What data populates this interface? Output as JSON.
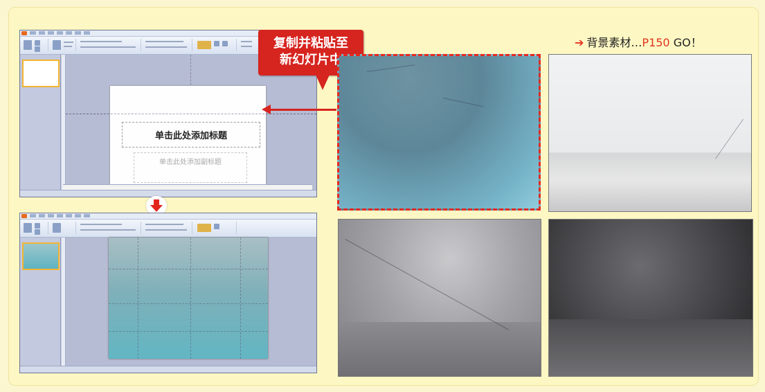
{
  "callout": {
    "text": "复制并粘贴至\n新幻灯片中"
  },
  "slide_before": {
    "title_placeholder": "单击此处添加标题",
    "subtitle_placeholder": "单击此处添加副标题"
  },
  "background_header": {
    "prefix": "背景素材…",
    "page": "P150",
    "suffix": " GO！"
  },
  "swatches": [
    {
      "name": "teal-gradient",
      "selected": true
    },
    {
      "name": "white-gradient",
      "selected": false
    },
    {
      "name": "gray-gradient",
      "selected": false
    },
    {
      "name": "dark-gradient",
      "selected": false
    }
  ],
  "colors": {
    "accent": "#d6241f",
    "panel_bg": "#fdf7c3"
  },
  "icons": {
    "arrow_left": "arrow-left-icon",
    "arrow_down": "arrow-down-icon",
    "arrow_right": "arrow-right-icon"
  }
}
